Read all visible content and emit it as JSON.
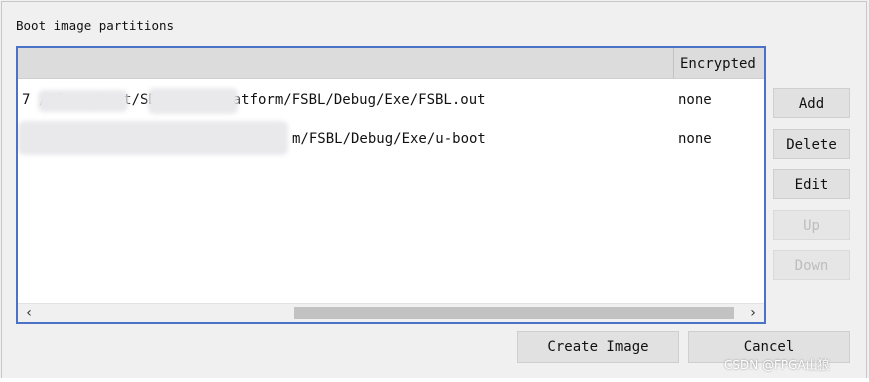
{
  "section_title": "Boot image partitions",
  "table": {
    "columns": [
      "Encrypted"
    ],
    "rows": [
      {
        "file": "7       /Linu  _test/SDK/sd_1_platform/FSBL/Debug/Exe/FSBL.out",
        "encrypted": "none"
      },
      {
        "file": "m/FSBL/Debug/Exe/u-boot",
        "encrypted": "none"
      }
    ],
    "scroll_left_icon": "‹",
    "scroll_right_icon": "›"
  },
  "side_buttons": {
    "add": "Add",
    "delete": "Delete",
    "edit": "Edit",
    "up": "Up",
    "down": "Down"
  },
  "bottom_buttons": {
    "create_image": "Create Image",
    "cancel": "Cancel"
  },
  "watermark": "CSDN @FPGA山狼",
  "colors": {
    "selection_border": "#4a72c6",
    "header_bg": "#dcdcdc",
    "button_bg": "#e1e1e1"
  }
}
